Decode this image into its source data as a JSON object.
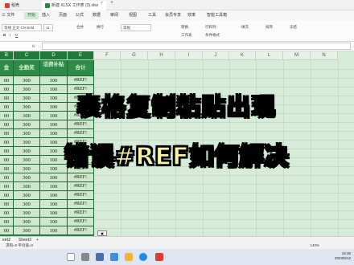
{
  "titlebar": {
    "tab1": "稻壳",
    "tab2": "新建 XLSX 工作表 (3).xlsx",
    "close": "×",
    "add": "+"
  },
  "menu": [
    "三 文件",
    "开始",
    "插入",
    "页面",
    "公式",
    "数据",
    "审阅",
    "视图",
    "工具",
    "会员专享",
    "效率",
    "智能工具箱"
  ],
  "ribbon": {
    "font_name": "等线 正文 CN Bold",
    "font_size": "11",
    "format": "常规",
    "merge": "合并",
    "wrap": "换行",
    "convert": "转换",
    "fill": "填充",
    "sort": "排序",
    "freeze": "冻结",
    "rowcol": "行和列",
    "worksheet": "工作表",
    "cond": "条件格式",
    "fx": "fx"
  },
  "columns": [
    "B",
    "C",
    "D",
    "E",
    "F",
    "G",
    "H",
    "I",
    "J",
    "K",
    "L",
    "M",
    "N"
  ],
  "table": {
    "headers": [
      "金",
      "全勤奖",
      "话费补贴",
      "合计"
    ],
    "rows": [
      [
        "00",
        "300",
        "100",
        "#REF!"
      ],
      [
        "00",
        "300",
        "100",
        "#REF!"
      ],
      [
        "00",
        "300",
        "100",
        "#REF!"
      ],
      [
        "00",
        "300",
        "100",
        "#REF!"
      ],
      [
        "00",
        "300",
        "100",
        "#REF!"
      ],
      [
        "00",
        "300",
        "100",
        "#REF!"
      ],
      [
        "00",
        "300",
        "100",
        "#REF!"
      ],
      [
        "00",
        "300",
        "100",
        "#REF!"
      ],
      [
        "00",
        "300",
        "100",
        "#REF!"
      ],
      [
        "00",
        "300",
        "100",
        "#REF!"
      ],
      [
        "00",
        "300",
        "100",
        "#REF!"
      ],
      [
        "00",
        "300",
        "100",
        "#REF!"
      ],
      [
        "00",
        "300",
        "100",
        "#REF!"
      ],
      [
        "00",
        "300",
        "100",
        "#REF!"
      ],
      [
        "00",
        "300",
        "100",
        "#REF!"
      ],
      [
        "00",
        "300",
        "100",
        "#REF!"
      ],
      [
        "00",
        "300",
        "100",
        "#REF!"
      ],
      [
        "00",
        "300",
        "100",
        "#REF!"
      ]
    ]
  },
  "captions": {
    "line1": "表格复制粘贴出现",
    "line2": "错误#REF如何解决"
  },
  "sheet_tabs": [
    "eet2",
    "Sheet3",
    "+"
  ],
  "status": {
    "left": "求和=0  平均值=0",
    "zoom": "140%"
  },
  "clock": {
    "time": "15:36",
    "date": "2023/5/12"
  },
  "colors": {
    "accent": "#2b8a45",
    "caption": "#f7f3a0"
  }
}
